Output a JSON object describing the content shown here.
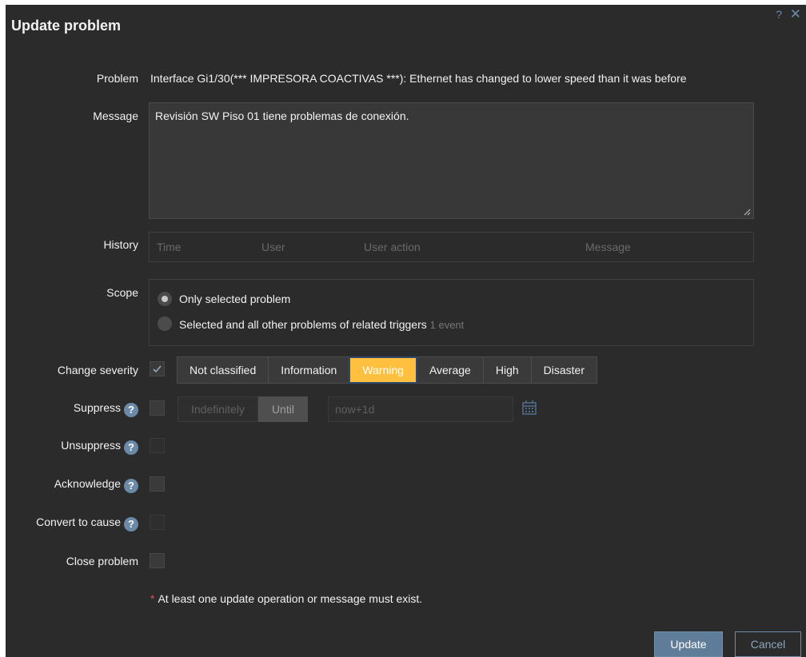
{
  "dialog": {
    "title": "Update problem",
    "help_icon": "?",
    "close_icon": "✕"
  },
  "labels": {
    "problem": "Problem",
    "message": "Message",
    "history": "History",
    "scope": "Scope",
    "change_severity": "Change severity",
    "suppress": "Suppress",
    "unsuppress": "Unsuppress",
    "acknowledge": "Acknowledge",
    "convert_to_cause": "Convert to cause",
    "close_problem": "Close problem",
    "help_badge": "?"
  },
  "problem_text": "Interface Gi1/30(*** IMPRESORA COACTIVAS ***): Ethernet has changed to lower speed than it was before",
  "message_value": "Revisión SW Piso 01 tiene problemas de conexión.",
  "history_columns": [
    "Time",
    "User",
    "User action",
    "Message"
  ],
  "scope": {
    "options": [
      "Only selected problem",
      "Selected and all other problems of related triggers"
    ],
    "selected_index": 0,
    "event_count": "1 event"
  },
  "change_severity": {
    "checked": true,
    "options": [
      "Not classified",
      "Information",
      "Warning",
      "Average",
      "High",
      "Disaster"
    ],
    "selected": "Warning"
  },
  "suppress": {
    "checked": false,
    "modes": [
      "Indefinitely",
      "Until"
    ],
    "selected_mode": "Until",
    "until_placeholder": "now+1d"
  },
  "checkbox_states": {
    "unsuppress": false,
    "acknowledge": false,
    "convert_to_cause": false,
    "close_problem": false
  },
  "note": {
    "asterisk": "*",
    "text": "At least one update operation or message must exist."
  },
  "buttons": {
    "update": "Update",
    "cancel": "Cancel"
  },
  "colors": {
    "dialog_bg": "#2b2b2b",
    "warning": "#ffc040",
    "accent": "#5f7d99",
    "required": "#e05050"
  }
}
